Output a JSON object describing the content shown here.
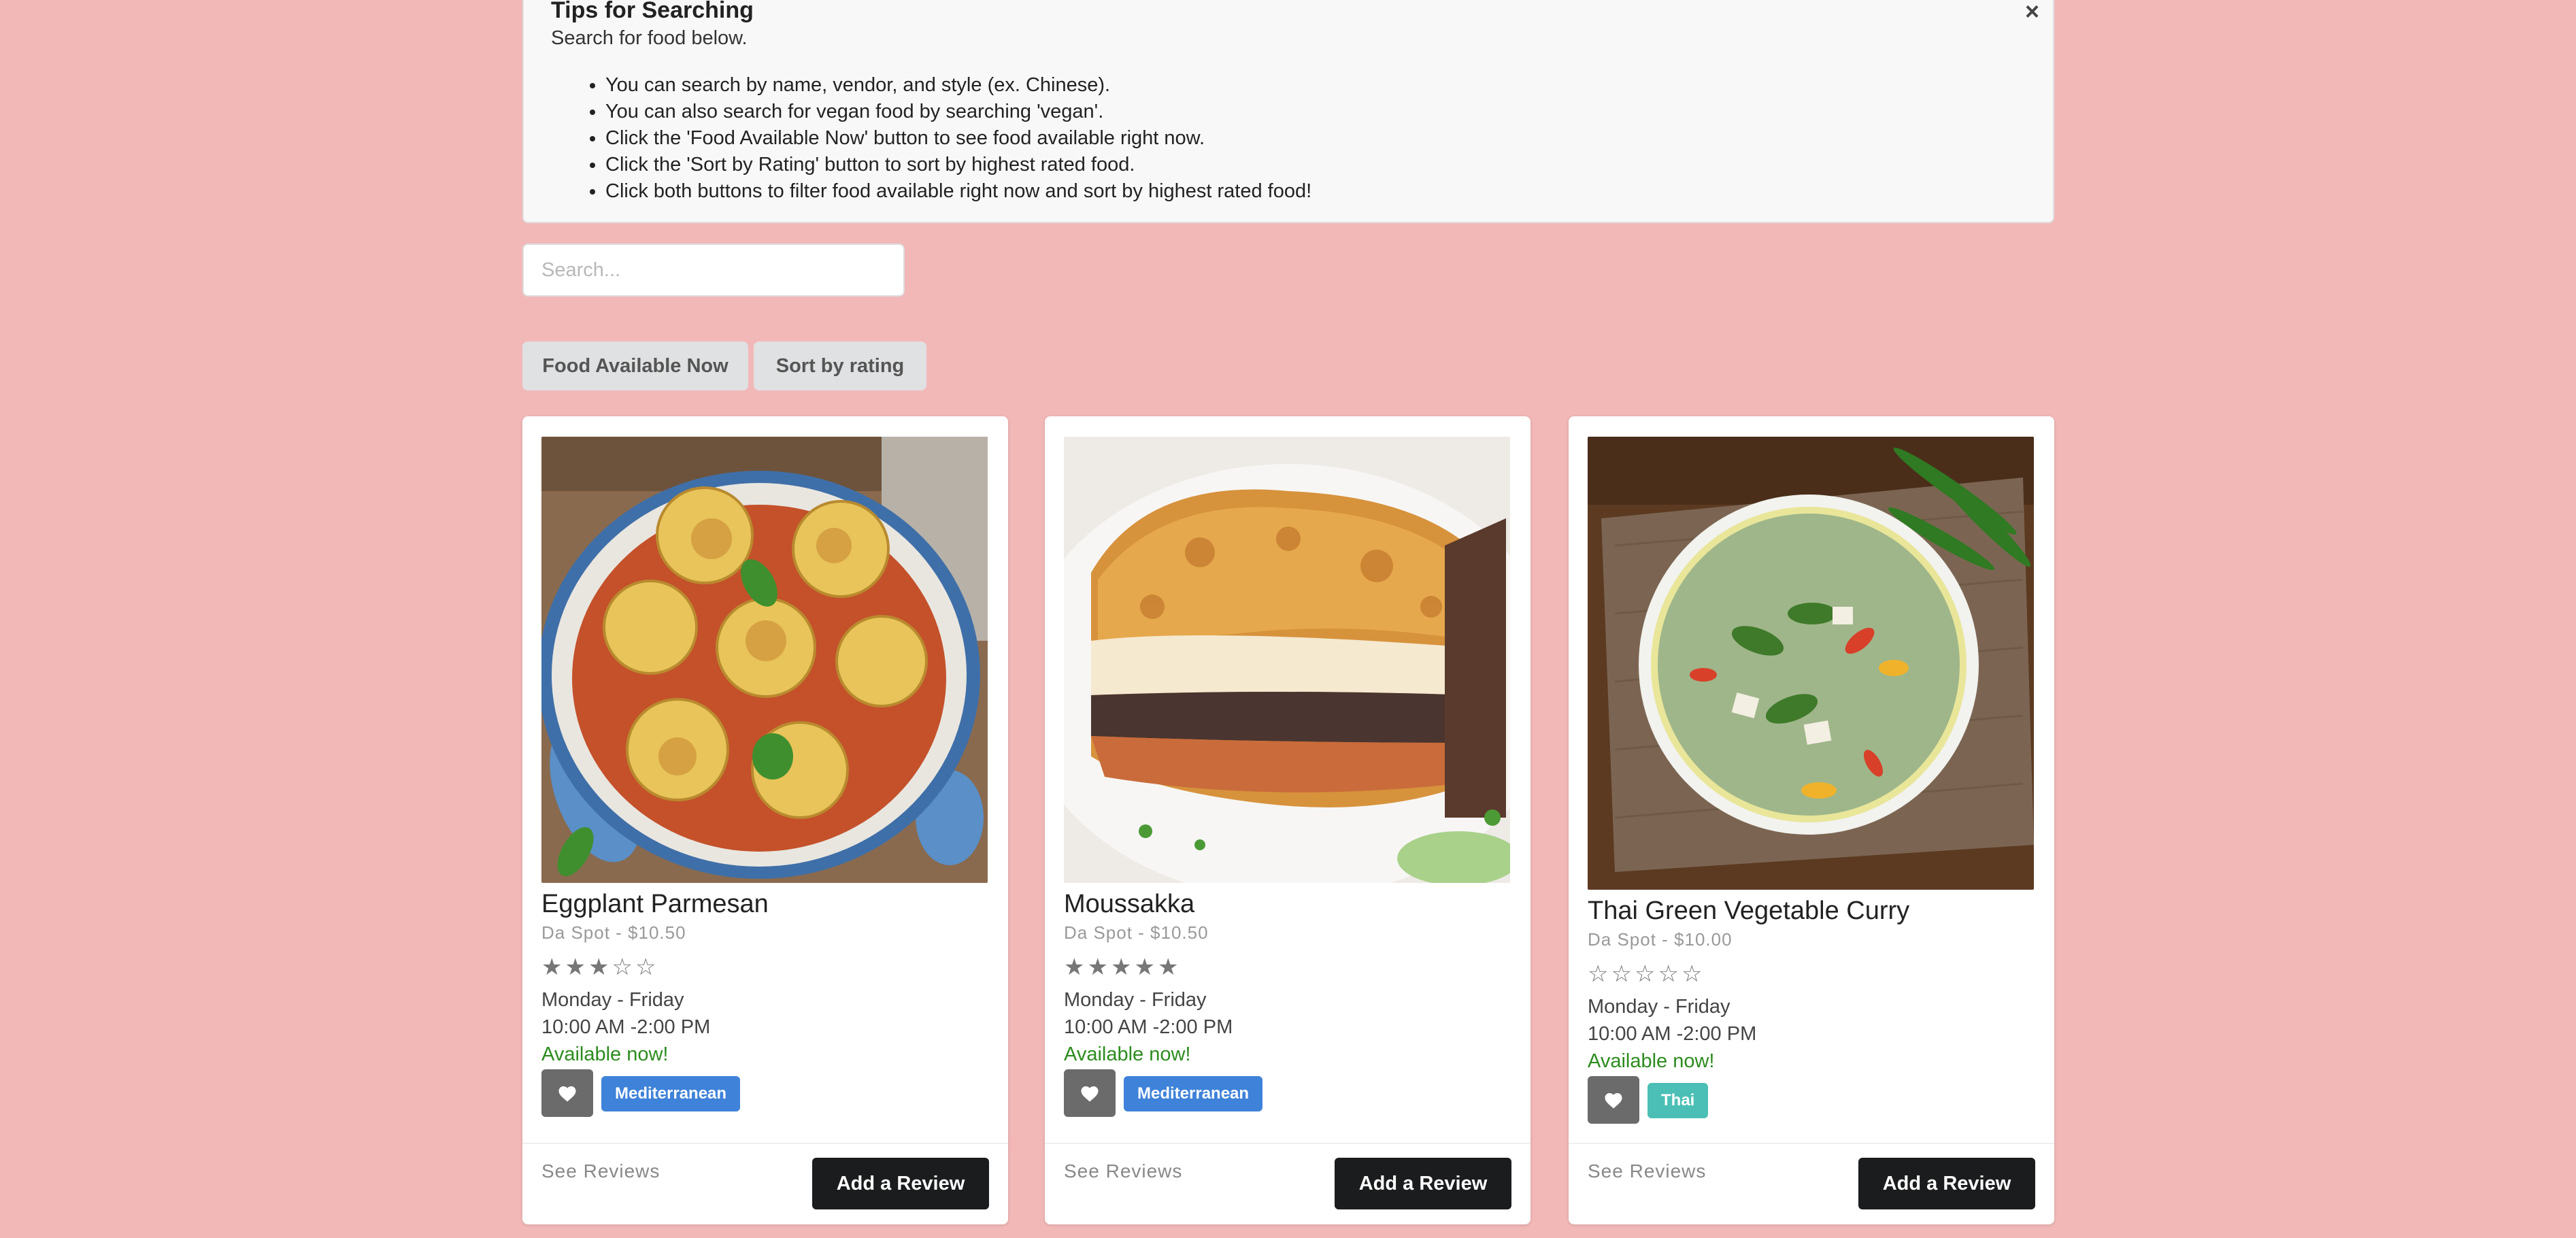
{
  "tips": {
    "title": "Tips for Searching",
    "subtitle": "Search for food below.",
    "close_icon": "×",
    "items": [
      "You can search by name, vendor, and style (ex. Chinese).",
      "You can also search for vegan food by searching 'vegan'.",
      "Click the 'Food Available Now' button to see food available right now.",
      "Click the 'Sort by Rating' button to sort by highest rated food.",
      "Click both buttons to filter food available right now and sort by highest rated food!"
    ]
  },
  "search": {
    "placeholder": "Search...",
    "value": ""
  },
  "filters": {
    "available_now": "Food Available Now",
    "sort_rating": "Sort by rating"
  },
  "cards": [
    {
      "title": "Eggplant Parmesan",
      "meta": "Da Spot - $10.50",
      "rating": 3,
      "rating_max": 5,
      "days": "Monday - Friday",
      "hours": "10:00 AM -2:00 PM",
      "availability": "Available now!",
      "tag": "Mediterranean",
      "tag_color": "#3e82d9",
      "see_reviews": "See Reviews",
      "add_review": "Add a Review"
    },
    {
      "title": "Moussakka",
      "meta": "Da Spot - $10.50",
      "rating": 5,
      "rating_max": 5,
      "days": "Monday - Friday",
      "hours": "10:00 AM -2:00 PM",
      "availability": "Available now!",
      "tag": "Mediterranean",
      "tag_color": "#3e82d9",
      "see_reviews": "See Reviews",
      "add_review": "Add a Review"
    },
    {
      "title": "Thai Green Vegetable Curry",
      "meta": "Da Spot - $10.00",
      "rating": 0,
      "rating_max": 5,
      "days": "Monday - Friday",
      "hours": "10:00 AM -2:00 PM",
      "availability": "Available now!",
      "tag": "Thai",
      "tag_color": "#4bbfb5",
      "see_reviews": "See Reviews",
      "add_review": "Add a Review"
    }
  ],
  "colors": {
    "page_background": "#f2b8b8",
    "available": "#2c8c1e",
    "add_review_button": "#1b1c1d",
    "heart_button": "#6b6b6b"
  },
  "icons": {
    "heart": "heart-icon",
    "star_filled": "star-filled-icon",
    "star_empty": "star-empty-icon",
    "close": "close-icon"
  }
}
